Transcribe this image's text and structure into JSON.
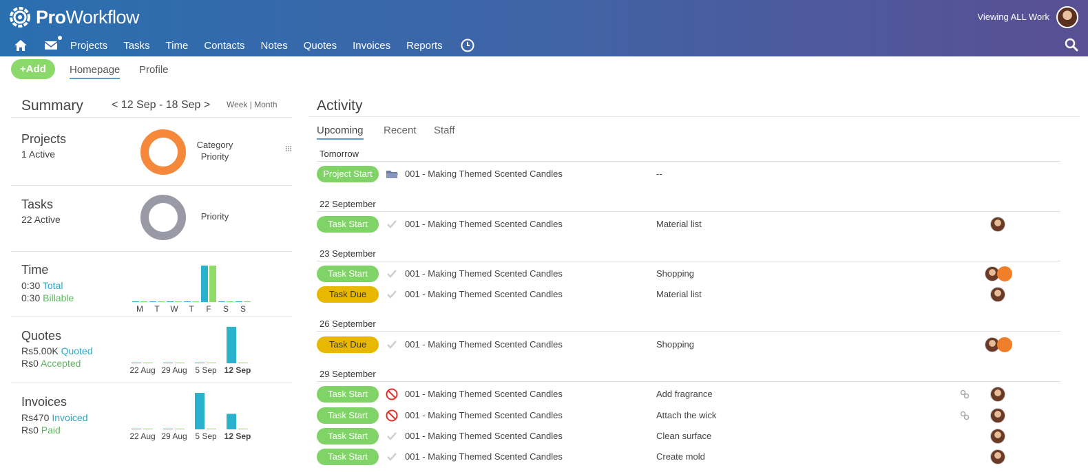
{
  "app": {
    "logo_bold": "Pro",
    "logo_rest": "Workflow",
    "viewing": "Viewing ALL Work"
  },
  "nav": {
    "items": [
      "Projects",
      "Tasks",
      "Time",
      "Contacts",
      "Notes",
      "Quotes",
      "Invoices",
      "Reports"
    ]
  },
  "subnav": {
    "add_label": "Add",
    "tabs": [
      "Homepage",
      "Profile"
    ]
  },
  "summary": {
    "title": "Summary",
    "range": "< 12 Sep - 18 Sep >",
    "range_switch": "Week | Month",
    "projects": {
      "title": "Projects",
      "count": "1",
      "status": "Active",
      "labels": [
        "Category",
        "Priority"
      ]
    },
    "tasks": {
      "title": "Tasks",
      "count": "22",
      "status": "Active",
      "labels": [
        "Priority"
      ]
    },
    "time": {
      "title": "Time",
      "total_value": "0:30",
      "total_label": "Total",
      "billable_value": "0:30",
      "billable_label": "Billable",
      "days": [
        "M",
        "T",
        "W",
        "T",
        "F",
        "S",
        "S"
      ],
      "total_hours": [
        0,
        0,
        0,
        0,
        0.5,
        0,
        0
      ],
      "billable_hours": [
        0,
        0,
        0,
        0,
        0.5,
        0,
        0
      ]
    },
    "quotes": {
      "title": "Quotes",
      "quoted_value": "Rs5.00K",
      "quoted_label": "Quoted",
      "accepted_value": "Rs0",
      "accepted_label": "Accepted",
      "weeks": [
        "22 Aug",
        "29 Aug",
        "5 Sep",
        "12 Sep"
      ],
      "quoted": [
        0,
        0,
        0,
        5000
      ],
      "accepted": [
        0,
        0,
        0,
        0
      ]
    },
    "invoices": {
      "title": "Invoices",
      "invoiced_value": "Rs470",
      "invoiced_label": "Invoiced",
      "paid_value": "Rs0",
      "paid_label": "Paid",
      "weeks": [
        "22 Aug",
        "29 Aug",
        "5 Sep",
        "12 Sep"
      ],
      "invoiced": [
        0,
        0,
        330,
        140
      ],
      "paid": [
        0,
        0,
        0,
        0
      ]
    }
  },
  "colors": {
    "start_badge": "#80d366",
    "due_badge": "#e8b800",
    "blue_bar": "#2ab2cc",
    "green_bar": "#8fdb6a",
    "projects_donut": "#f5883a",
    "tasks_donut": "#9a9aa6"
  },
  "activity": {
    "title": "Activity",
    "tabs": [
      "Upcoming",
      "Recent",
      "Staff"
    ],
    "groups": [
      {
        "date": "Tomorrow",
        "rows": [
          {
            "badge": "Project Start",
            "kind": "start",
            "icon": "folder-icon",
            "project": "001 - Making Themed Scented Candles",
            "task": "--",
            "link": false,
            "avatars": []
          }
        ]
      },
      {
        "date": "22 September",
        "rows": [
          {
            "badge": "Task Start",
            "kind": "start",
            "icon": "check-icon",
            "project": "001 - Making Themed Scented Candles",
            "task": "Material list",
            "link": false,
            "avatars": [
              "user"
            ]
          }
        ]
      },
      {
        "date": "23 September",
        "rows": [
          {
            "badge": "Task Start",
            "kind": "start",
            "icon": "check-icon",
            "project": "001 - Making Themed Scented Candles",
            "task": "Shopping",
            "link": false,
            "avatars": [
              "user",
              "org"
            ]
          },
          {
            "badge": "Task Due",
            "kind": "due",
            "icon": "check-icon",
            "project": "001 - Making Themed Scented Candles",
            "task": "Material list",
            "link": false,
            "avatars": [
              "user"
            ]
          }
        ]
      },
      {
        "date": "26 September",
        "rows": [
          {
            "badge": "Task Due",
            "kind": "due",
            "icon": "check-icon",
            "project": "001 - Making Themed Scented Candles",
            "task": "Shopping",
            "link": false,
            "avatars": [
              "user",
              "org"
            ]
          }
        ]
      },
      {
        "date": "29 September",
        "rows": [
          {
            "badge": "Task Start",
            "kind": "start",
            "icon": "blocked-icon",
            "project": "001 - Making Themed Scented Candles",
            "task": "Add fragrance",
            "link": true,
            "avatars": [
              "user"
            ]
          },
          {
            "badge": "Task Start",
            "kind": "start",
            "icon": "blocked-icon",
            "project": "001 - Making Themed Scented Candles",
            "task": "Attach the wick",
            "link": true,
            "avatars": [
              "user"
            ]
          },
          {
            "badge": "Task Start",
            "kind": "start",
            "icon": "check-icon",
            "project": "001 - Making Themed Scented Candles",
            "task": "Clean surface",
            "link": false,
            "avatars": [
              "user"
            ]
          },
          {
            "badge": "Task Start",
            "kind": "start",
            "icon": "check-icon",
            "project": "001 - Making Themed Scented Candles",
            "task": "Create mold",
            "link": false,
            "avatars": [
              "user"
            ]
          }
        ]
      }
    ]
  }
}
